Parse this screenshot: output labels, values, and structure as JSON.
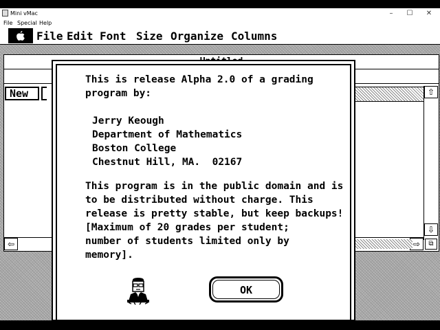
{
  "host": {
    "title": "Mini vMac",
    "menu": [
      "File",
      "Special",
      "Help"
    ],
    "controls": {
      "minimize": "–",
      "maximize": "☐",
      "close": "✕"
    }
  },
  "mac_menu": {
    "apple": "",
    "items": [
      "File",
      "Edit",
      "Font",
      "Size",
      "Organize",
      "Columns"
    ]
  },
  "document": {
    "title": "Untitled",
    "new_button": "New",
    "icons": {
      "scroll_up": "up-arrow-icon",
      "scroll_down": "down-arrow-icon",
      "scroll_left": "left-arrow-icon",
      "scroll_right": "right-arrow-icon",
      "grow": "grow-box-icon"
    }
  },
  "dialog": {
    "intro": [
      "This is release Alpha 2.0 of a grading",
      "program by:"
    ],
    "address": [
      "Jerry Keough",
      "Department of Mathematics",
      "Boston College",
      "Chestnut Hill, MA.  02167"
    ],
    "notice": [
      "This program is in the public domain and is",
      "to be distributed without charge. This",
      "release is pretty stable, but keep backups!",
      "[Maximum of 20 grades per student;",
      "number of students limited only by",
      "memory]."
    ],
    "ok_label": "OK",
    "author_icon": "author-portrait-icon"
  },
  "colors": {
    "foreground": "#000000",
    "background": "#ffffff",
    "desktop": "#a9a9a9"
  }
}
